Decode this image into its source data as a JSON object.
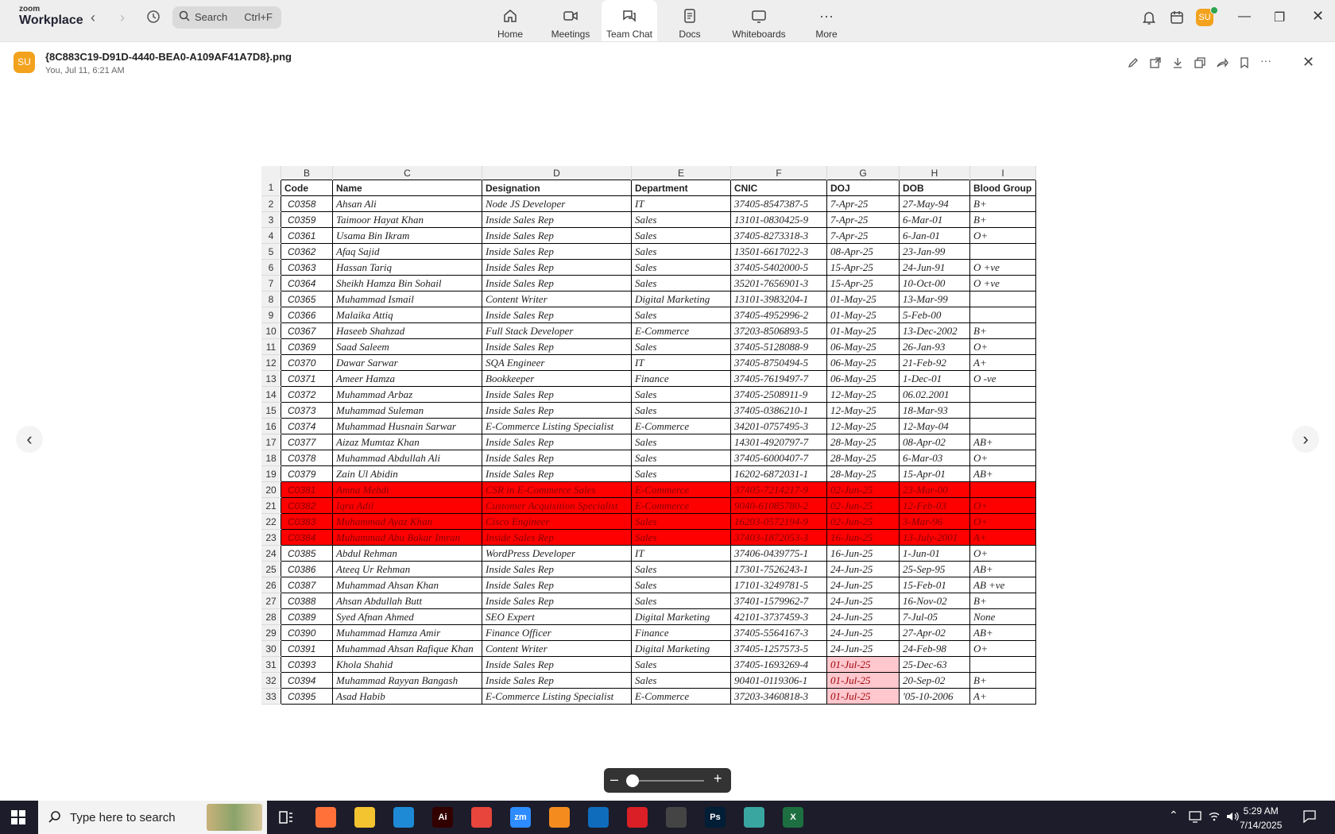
{
  "app": {
    "brand_small": "zoom",
    "brand_name": "Workplace"
  },
  "search": {
    "label": "Search",
    "shortcut": "Ctrl+F"
  },
  "tabs": [
    {
      "label": "Home",
      "icon": "home-icon"
    },
    {
      "label": "Meetings",
      "icon": "video-camera-icon"
    },
    {
      "label": "Team Chat",
      "icon": "chat-icon",
      "active": true
    },
    {
      "label": "Docs",
      "icon": "document-icon"
    },
    {
      "label": "Whiteboards",
      "icon": "whiteboard-icon"
    },
    {
      "label": "More",
      "icon": "more-dots-icon"
    }
  ],
  "user": {
    "initials": "SU"
  },
  "message": {
    "sender_initials": "SU",
    "filename": "{8C883C19-D91D-4440-BEA0-A109AF41A7D8}.png",
    "meta": "You, Jul 11, 6:21 AM"
  },
  "sheet": {
    "col_letters": [
      "B",
      "C",
      "D",
      "E",
      "F",
      "G",
      "H",
      "I"
    ],
    "header_row_num": "1",
    "headers": [
      "Code",
      "Name",
      "Designation",
      "Department",
      "CNIC",
      "DOJ",
      "DOB",
      "Blood Group"
    ],
    "rows": [
      {
        "n": "2",
        "cells": [
          "C0358",
          "Ahsan Ali",
          "Node JS Developer",
          "IT",
          "37405-8547387-5",
          "7-Apr-25",
          "27-May-94",
          "B+"
        ]
      },
      {
        "n": "3",
        "cells": [
          "C0359",
          "Taimoor Hayat Khan",
          "Inside Sales Rep",
          "Sales",
          "13101-0830425-9",
          "7-Apr-25",
          "6-Mar-01",
          "B+"
        ]
      },
      {
        "n": "4",
        "cells": [
          "C0361",
          "Usama Bin Ikram",
          "Inside Sales Rep",
          "Sales",
          "37405-8273318-3",
          "7-Apr-25",
          "6-Jan-01",
          "O+"
        ]
      },
      {
        "n": "5",
        "cells": [
          "C0362",
          "Afaq Sajid",
          "Inside Sales Rep",
          "Sales",
          "13501-6617022-3",
          "08-Apr-25",
          "23-Jan-99",
          ""
        ]
      },
      {
        "n": "6",
        "cells": [
          "C0363",
          "Hassan Tariq",
          "Inside Sales Rep",
          "Sales",
          "37405-5402000-5",
          "15-Apr-25",
          "24-Jun-91",
          "O +ve"
        ]
      },
      {
        "n": "7",
        "cells": [
          "C0364",
          "Sheikh Hamza Bin Sohail",
          "Inside Sales Rep",
          "Sales",
          "35201-7656901-3",
          "15-Apr-25",
          "10-Oct-00",
          "O +ve"
        ]
      },
      {
        "n": "8",
        "cells": [
          "C0365",
          "Muhammad Ismail",
          "Content Writer",
          "Digital Marketing",
          "13101-3983204-1",
          "01-May-25",
          "13-Mar-99",
          ""
        ]
      },
      {
        "n": "9",
        "cells": [
          "C0366",
          "Malaika Attiq",
          "Inside Sales Rep",
          "Sales",
          "37405-4952996-2",
          "01-May-25",
          "5-Feb-00",
          ""
        ]
      },
      {
        "n": "10",
        "cells": [
          "C0367",
          "Haseeb Shahzad",
          "Full Stack Developer",
          "E-Commerce",
          "37203-8506893-5",
          "01-May-25",
          "13-Dec-2002",
          "B+"
        ]
      },
      {
        "n": "11",
        "cells": [
          "C0369",
          "Saad Saleem",
          "Inside Sales Rep",
          "Sales",
          "37405-5128088-9",
          "06-May-25",
          "26-Jan-93",
          "O+"
        ]
      },
      {
        "n": "12",
        "cells": [
          "C0370",
          "Dawar Sarwar",
          "SQA Engineer",
          "IT",
          "37405-8750494-5",
          "06-May-25",
          "21-Feb-92",
          "A+"
        ]
      },
      {
        "n": "13",
        "cells": [
          "C0371",
          "Ameer Hamza",
          "Bookkeeper",
          "Finance",
          "37405-7619497-7",
          "06-May-25",
          "1-Dec-01",
          "O -ve"
        ]
      },
      {
        "n": "14",
        "cells": [
          "C0372",
          "Muhammad Arbaz",
          "Inside Sales Rep",
          "Sales",
          "37405-2508911-9",
          "12-May-25",
          "06.02.2001",
          ""
        ]
      },
      {
        "n": "15",
        "cells": [
          "C0373",
          "Muhammad Suleman",
          "Inside Sales Rep",
          "Sales",
          "37405-0386210-1",
          "12-May-25",
          "18-Mar-93",
          ""
        ]
      },
      {
        "n": "16",
        "cells": [
          "C0374",
          "Muhammad Husnain Sarwar",
          "E-Commerce Listing Specialist",
          "E-Commerce",
          "34201-0757495-3",
          "12-May-25",
          "12-May-04",
          ""
        ]
      },
      {
        "n": "17",
        "cells": [
          "C0377",
          "Aizaz Mumtaz Khan",
          "Inside Sales Rep",
          "Sales",
          "14301-4920797-7",
          "28-May-25",
          "08-Apr-02",
          "AB+"
        ]
      },
      {
        "n": "18",
        "cells": [
          "C0378",
          "Muhammad Abdullah Ali",
          "Inside Sales Rep",
          "Sales",
          "37405-6000407-7",
          "28-May-25",
          "6-Mar-03",
          "O+"
        ]
      },
      {
        "n": "19",
        "cells": [
          "C0379",
          "Zain Ul Abidin",
          "Inside Sales Rep",
          "Sales",
          "16202-6872031-1",
          "28-May-25",
          "15-Apr-01",
          "AB+"
        ]
      },
      {
        "n": "20",
        "red": true,
        "cells": [
          "C0381",
          "Amna Mehdi",
          "CSR in E-Commerce Sales",
          "E-Commerce",
          "37405-7214217-9",
          "02-Jun-25",
          "23-Mar-00",
          ""
        ]
      },
      {
        "n": "21",
        "red": true,
        "cells": [
          "C0382",
          "Iqra Adil",
          "Customer Acquisition Specialist",
          "E-Commerce",
          "9040-61085780-2",
          "02-Jun-25",
          "12-Feb-03",
          "O+"
        ]
      },
      {
        "n": "22",
        "red": true,
        "cells": [
          "C0383",
          "Muhammad Ayaz Khan",
          "Cisco Engineer",
          "Sales",
          "16203-0572194-9",
          "02-Jun-25",
          "3-Mar-96",
          "O+"
        ]
      },
      {
        "n": "23",
        "red": true,
        "cells": [
          "C0384",
          "Muhammad Abu Bakar Imran",
          "Inside Sales Rep",
          "Sales",
          "37403-1872053-3",
          "16-Jun-25",
          "13-July-2001",
          "A+"
        ]
      },
      {
        "n": "24",
        "cells": [
          "C0385",
          "Abdul Rehman",
          "WordPress Developer",
          "IT",
          "37406-0439775-1",
          "16-Jun-25",
          "1-Jun-01",
          "O+"
        ]
      },
      {
        "n": "25",
        "cells": [
          "C0386",
          "Ateeq Ur Rehman",
          "Inside Sales Rep",
          "Sales",
          "17301-7526243-1",
          "24-Jun-25",
          "25-Sep-95",
          "AB+"
        ]
      },
      {
        "n": "26",
        "cells": [
          "C0387",
          "Muhammad Ahsan Khan",
          "Inside Sales Rep",
          "Sales",
          "17101-3249781-5",
          "24-Jun-25",
          "15-Feb-01",
          "AB +ve"
        ]
      },
      {
        "n": "27",
        "cells": [
          "C0388",
          "Ahsan Abdullah Butt",
          "Inside Sales Rep",
          "Sales",
          "37401-1579962-7",
          "24-Jun-25",
          "16-Nov-02",
          "B+"
        ]
      },
      {
        "n": "28",
        "cells": [
          "C0389",
          "Syed Afnan Ahmed",
          "SEO Expert",
          "Digital Marketing",
          "42101-3737459-3",
          "24-Jun-25",
          "7-Jul-05",
          "None"
        ]
      },
      {
        "n": "29",
        "cells": [
          "C0390",
          "Muhammad Hamza Amir",
          "Finance Officer",
          "Finance",
          "37405-5564167-3",
          "24-Jun-25",
          "27-Apr-02",
          "AB+"
        ]
      },
      {
        "n": "30",
        "cells": [
          "C0391",
          "Muhammad Ahsan Rafique Khan",
          "Content Writer",
          "Digital Marketing",
          "37405-1257573-5",
          "24-Jun-25",
          "24-Feb-98",
          "O+"
        ]
      },
      {
        "n": "31",
        "pinkdoj": true,
        "cells": [
          "C0393",
          "Khola Shahid",
          "Inside Sales Rep",
          "Sales",
          "37405-1693269-4",
          "01-Jul-25",
          "25-Dec-63",
          ""
        ]
      },
      {
        "n": "32",
        "pinkdoj": true,
        "cells": [
          "C0394",
          "Muhammad Rayyan Bangash",
          "Inside Sales Rep",
          "Sales",
          "90401-0119306-1",
          "01-Jul-25",
          "20-Sep-02",
          "B+"
        ]
      },
      {
        "n": "33",
        "pinkdoj": true,
        "cells": [
          "C0395",
          "Asad Habib",
          "E-Commerce Listing Specialist",
          "E-Commerce",
          "37203-3460818-3",
          "01-Jul-25",
          "'05-10-2006",
          "A+"
        ]
      }
    ]
  },
  "taskbar": {
    "search_placeholder": "Type here to search",
    "time": "5:29 AM",
    "date": "7/14/2025",
    "apps": [
      {
        "name": "firefox",
        "label": "",
        "color": "#ff7139"
      },
      {
        "name": "file-explorer",
        "label": "",
        "color": "#f4c430"
      },
      {
        "name": "vscode",
        "label": "",
        "color": "#1e8ad6"
      },
      {
        "name": "illustrator",
        "label": "Ai",
        "color": "#330000"
      },
      {
        "name": "chrome",
        "label": "",
        "color": "#e8453c"
      },
      {
        "name": "zoom",
        "label": "zm",
        "color": "#2d8cff"
      },
      {
        "name": "xampp",
        "label": "",
        "color": "#f48b1f"
      },
      {
        "name": "outlook",
        "label": "",
        "color": "#0f6cbd"
      },
      {
        "name": "creative-cloud",
        "label": "",
        "color": "#da1f26"
      },
      {
        "name": "pen-tool",
        "label": "",
        "color": "#444444"
      },
      {
        "name": "photoshop",
        "label": "Ps",
        "color": "#001e36"
      },
      {
        "name": "app-gem",
        "label": "",
        "color": "#3aa6a0"
      },
      {
        "name": "excel",
        "label": "X",
        "color": "#1d6f42"
      }
    ]
  },
  "colors": {
    "accent": "#f2a21c",
    "red_row": "#ff0000",
    "pink_cell": "#ffc7ce"
  }
}
